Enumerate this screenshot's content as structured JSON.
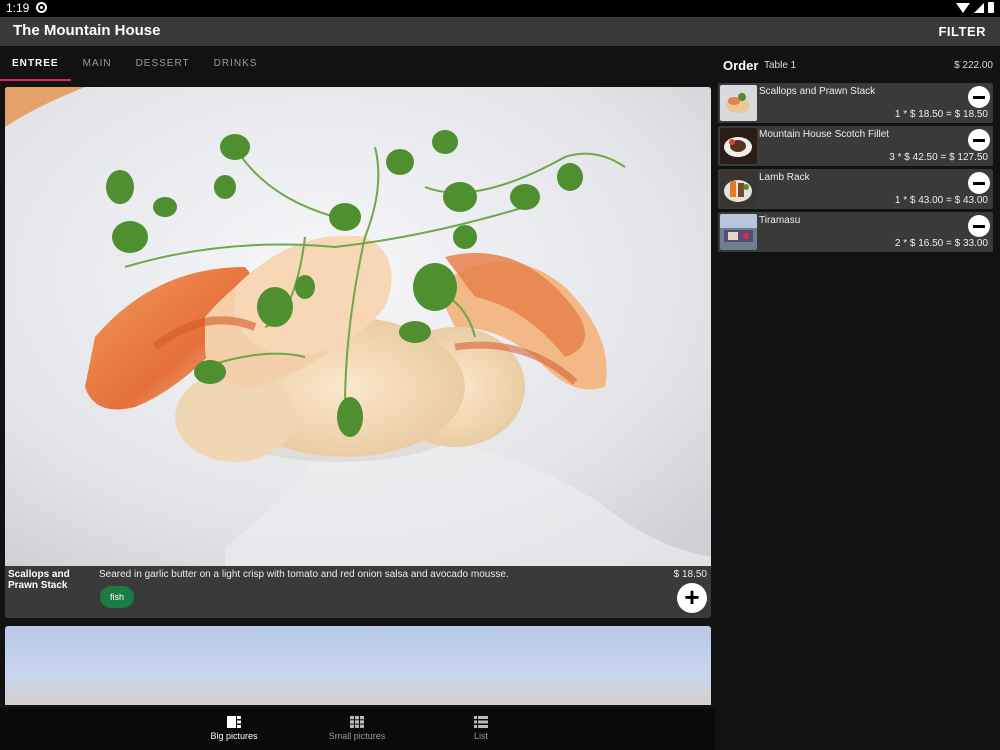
{
  "status": {
    "time": "1:19"
  },
  "app_bar": {
    "title": "The Mountain House",
    "filter_label": "FILTER"
  },
  "tabs": [
    {
      "label": "ENTREE",
      "active": true
    },
    {
      "label": "MAIN",
      "active": false
    },
    {
      "label": "DESSERT",
      "active": false
    },
    {
      "label": "DRINKS",
      "active": false
    }
  ],
  "menu": {
    "items": [
      {
        "name": "Scallops and Prawn Stack",
        "description": "Seared in garlic butter on a light crisp with tomato and red onion salsa and avocado mousse.",
        "price": "$ 18.50",
        "tag": "fish",
        "add_icon": "plus-icon"
      }
    ]
  },
  "bottom_nav": [
    {
      "label": "Big pictures",
      "icon": "big-pictures-icon",
      "active": true
    },
    {
      "label": "Small pictures",
      "icon": "grid-icon",
      "active": false
    },
    {
      "label": "List",
      "icon": "list-icon",
      "active": false
    }
  ],
  "order": {
    "title": "Order",
    "table": "Table 1",
    "total": "$ 222.00",
    "items": [
      {
        "name": "Scallops and Prawn Stack",
        "calc": "1 * $ 18.50 = $ 18.50"
      },
      {
        "name": "Mountain House Scotch Fillet",
        "calc": "3 * $ 42.50 = $ 127.50"
      },
      {
        "name": "Lamb Rack",
        "calc": "1 * $ 43.00 = $ 43.00"
      },
      {
        "name": "Tiramasu",
        "calc": "2 * $ 16.50 = $ 33.00"
      }
    ]
  },
  "colors": {
    "accent": "#e91e63",
    "tag": "#1b7b45",
    "surface": "#3a3a3a",
    "background": "#121212"
  }
}
